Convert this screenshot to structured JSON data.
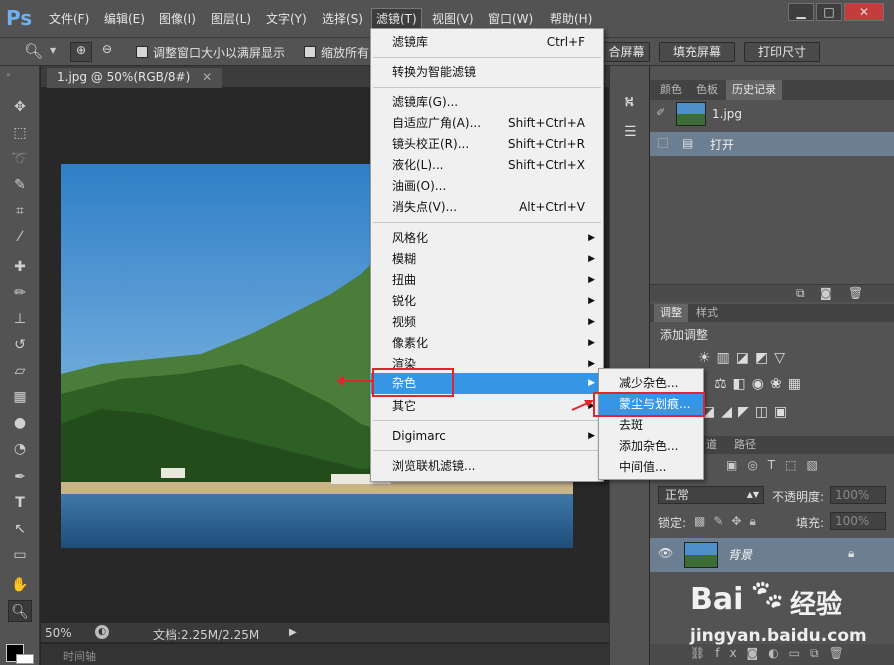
{
  "menubar": {
    "logo": "Ps",
    "items": [
      "文件(F)",
      "编辑(E)",
      "图像(I)",
      "图层(L)",
      "文字(Y)",
      "选择(S)",
      "滤镜(T)",
      "视图(V)",
      "窗口(W)",
      "帮助(H)"
    ],
    "window_controls": [
      "▁",
      "□",
      "✕"
    ]
  },
  "options": {
    "checkbox1": "调整窗口大小以满屏显示",
    "checkbox2": "缩放所有",
    "fit_screen": "合屏幕",
    "fill_screen": "填充屏幕",
    "print_size": "打印尺寸"
  },
  "document": {
    "tab_title": "1.jpg @ 50%(RGB/8#)",
    "zoom": "50%",
    "doc_info": "文档:2.25M/2.25M",
    "timeline": "时间轴"
  },
  "filter_menu": {
    "items": [
      {
        "label": "滤镜库",
        "shortcut": "Ctrl+F"
      },
      {
        "label": "转换为智能滤镜"
      },
      {
        "label": "滤镜库(G)..."
      },
      {
        "label": "自适应广角(A)...",
        "shortcut": "Shift+Ctrl+A"
      },
      {
        "label": "镜头校正(R)...",
        "shortcut": "Shift+Ctrl+R"
      },
      {
        "label": "液化(L)...",
        "shortcut": "Shift+Ctrl+X"
      },
      {
        "label": "油画(O)..."
      },
      {
        "label": "消失点(V)...",
        "shortcut": "Alt+Ctrl+V"
      },
      {
        "label": "风格化"
      },
      {
        "label": "模糊"
      },
      {
        "label": "扭曲"
      },
      {
        "label": "锐化"
      },
      {
        "label": "视频"
      },
      {
        "label": "像素化"
      },
      {
        "label": "渲染"
      },
      {
        "label": "杂色"
      },
      {
        "label": "其它"
      },
      {
        "label": "Digimarc"
      },
      {
        "label": "浏览联机滤镜..."
      }
    ]
  },
  "noise_submenu": {
    "items": [
      "减少杂色...",
      "蒙尘与划痕...",
      "去斑",
      "添加杂色...",
      "中间值..."
    ]
  },
  "history_panel": {
    "tabs": [
      "颜色",
      "色板",
      "历史记录"
    ],
    "snapshot": "1.jpg",
    "step": "打开"
  },
  "adjust_panel": {
    "tabs": [
      "调整",
      "样式"
    ],
    "title": "添加调整"
  },
  "layers_panel": {
    "tabs": [
      "道",
      "路径"
    ],
    "blend_mode": "正常",
    "opacity_label": "不透明度:",
    "opacity": "100%",
    "lock_label": "锁定:",
    "fill_label": "填充:",
    "fill": "100%",
    "layer_name": "背景"
  },
  "watermark": {
    "brand": "Bai",
    "brand2": "经验",
    "url": "jingyan.baidu.com"
  },
  "colors": {
    "accent": "#3596e6",
    "highlight_box": "#e0262b"
  }
}
